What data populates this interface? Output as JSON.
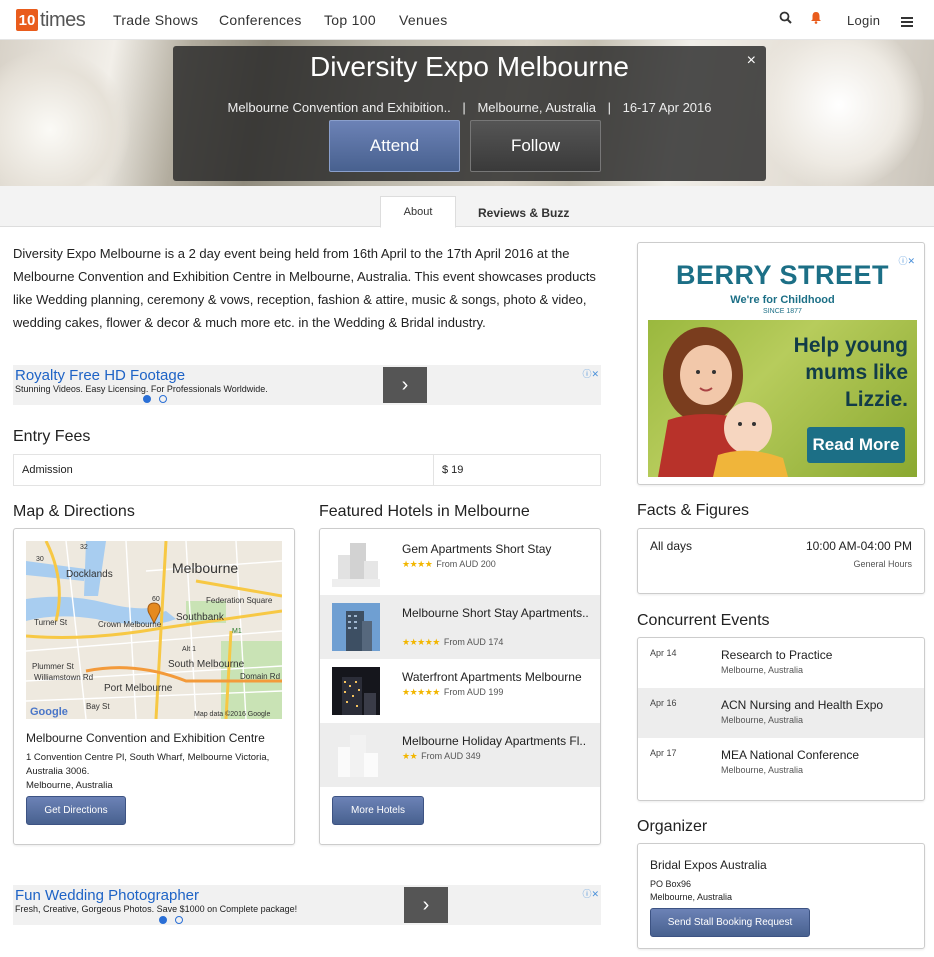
{
  "nav": {
    "logo_number": "10",
    "logo_text": "times",
    "links": [
      "Trade Shows",
      "Conferences",
      "Top 100",
      "Venues"
    ],
    "login": "Login"
  },
  "hero": {
    "title": "Diversity Expo Melbourne",
    "venue": "Melbourne Convention and Exhibition..",
    "location": "Melbourne, Australia",
    "dates": "16-17 Apr 2016",
    "separator": "|",
    "close": "×",
    "attend": "Attend",
    "follow": "Follow"
  },
  "tabs": {
    "about": "About",
    "reviews": "Reviews & Buzz"
  },
  "description": "Diversity Expo Melbourne is a 2 day event being held from 16th April to the 17th April 2016 at the Melbourne Convention and Exhibition Centre in Melbourne, Australia. This event showcases products like Wedding planning, ceremony & vows, reception, fashion & attire, music & songs, photo & video, wedding cakes, flower & decor & much more etc. in the Wedding & Bridal industry.",
  "ad1": {
    "title": "Royalty Free HD Footage",
    "line": "Stunning Videos. Easy Licensing. For Professionals Worldwide.",
    "arrow": "›",
    "badge": "ⓘ✕"
  },
  "entry_fees": {
    "heading": "Entry Fees",
    "label": "Admission",
    "price": "$ 19"
  },
  "map_section": {
    "heading": "Map & Directions",
    "venue": "Melbourne Convention and Exhibition Centre",
    "address": "1 Convention Centre Pl, South Wharf, Melbourne Victoria, Australia 3006.",
    "city": "Melbourne, Australia",
    "button": "Get Directions",
    "map_labels": {
      "docklands": "Docklands",
      "melbourne": "Melbourne",
      "federation": "Federation Square",
      "southbank": "Southbank",
      "crown": "Crown Melbourne",
      "turner": "Turner St",
      "south_melb": "South Melbourne",
      "plummer": "Plummer St",
      "williamstown": "Williamstown Rd",
      "port": "Port Melbourne",
      "domain": "Domain Rd",
      "bay": "Bay St",
      "google": "Google",
      "attribution": "Map data ©2016 Google",
      "route_m1": "M1",
      "route_alt1": "Alt 1",
      "route_30": "30",
      "route_32": "32",
      "route_60": "60"
    }
  },
  "hotels": {
    "heading": "Featured Hotels in Melbourne",
    "items": [
      {
        "name": "Gem Apartments Short Stay",
        "stars": "★★★★",
        "price": "From AUD 200"
      },
      {
        "name": "Melbourne Short Stay Apartments..",
        "stars": "★★★★★",
        "price": "From AUD 174"
      },
      {
        "name": "Waterfront Apartments Melbourne",
        "stars": "★★★★★",
        "price": "From AUD 199"
      },
      {
        "name": "Melbourne Holiday Apartments Fl..",
        "stars": "★★",
        "price": "From AUD 349"
      }
    ],
    "button": "More Hotels"
  },
  "ad2": {
    "title": "Fun Wedding Photographer",
    "line": "Fresh, Creative, Gorgeous Photos. Save $1000 on Complete package!",
    "arrow": "›",
    "badge": "ⓘ✕"
  },
  "sponsor": {
    "brand": "BERRY STREET",
    "tagline": "We're for Childhood",
    "since": "SINCE 1877",
    "headline": "Help young mums like Lizzie.",
    "button": "Read More",
    "badge": "ⓘ✕"
  },
  "facts": {
    "heading": "Facts & Figures",
    "label": "All days",
    "hours": "10:00 AM-04:00 PM",
    "type": "General Hours"
  },
  "concurrent": {
    "heading": "Concurrent Events",
    "items": [
      {
        "date": "Apr 14",
        "name": "Research to Practice",
        "location": "Melbourne, Australia"
      },
      {
        "date": "Apr 16",
        "name": "ACN Nursing and Health Expo",
        "location": "Melbourne, Australia"
      },
      {
        "date": "Apr 17",
        "name": "MEA National Conference",
        "location": "Melbourne, Australia"
      }
    ]
  },
  "organizer": {
    "heading": "Organizer",
    "name": "Bridal Expos Australia",
    "po": "PO Box96",
    "city": "Melbourne, Australia",
    "button": "Send Stall Booking Request"
  },
  "colors": {
    "brand_orange": "#e95c1c",
    "button_blue": "#5a71a3",
    "link_blue": "#1e63c6",
    "star_gold": "#f2b600",
    "berry_teal": "#1c6f86"
  }
}
